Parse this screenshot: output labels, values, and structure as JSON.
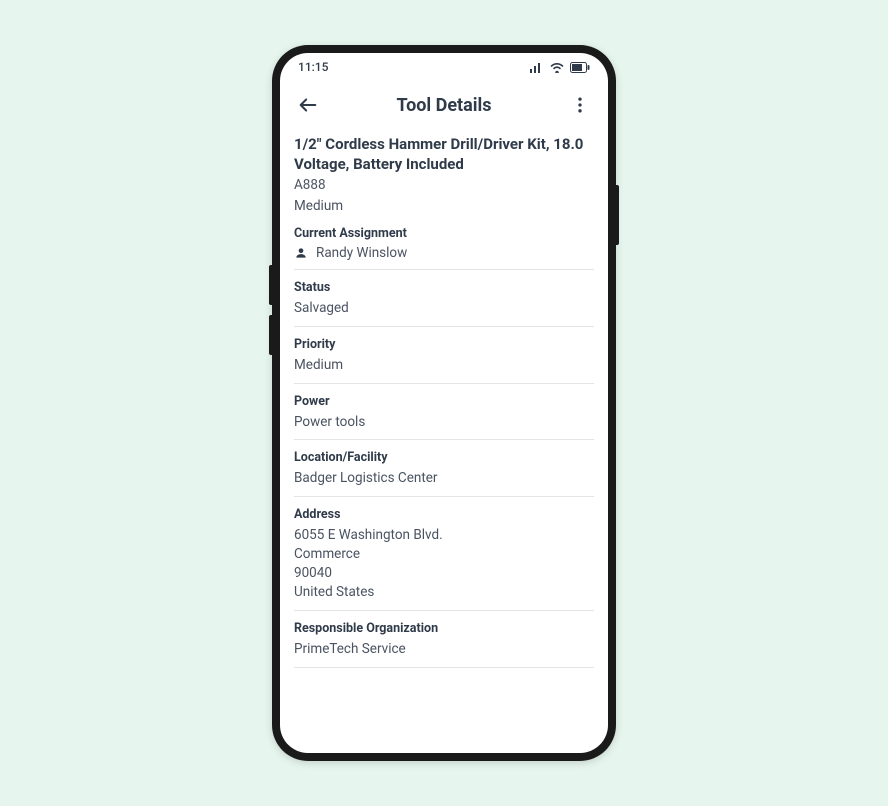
{
  "status_bar": {
    "time": "11:15"
  },
  "app_bar": {
    "title": "Tool Details"
  },
  "tool": {
    "name": "1/2\" Cordless Hammer Drill/Driver Kit, 18.0 Voltage, Battery Included",
    "code": "A888",
    "sub": "Medium"
  },
  "sections": {
    "assignment": {
      "label": "Current Assignment",
      "value": "Randy Winslow"
    },
    "status": {
      "label": "Status",
      "value": "Salvaged"
    },
    "priority": {
      "label": "Priority",
      "value": "Medium"
    },
    "power": {
      "label": "Power",
      "value": "Power tools"
    },
    "location": {
      "label": "Location/Facility",
      "value": "Badger Logistics Center"
    },
    "address": {
      "label": "Address",
      "line1": "6055 E Washington Blvd.",
      "line2": "Commerce",
      "line3": "90040",
      "line4": "United States"
    },
    "org": {
      "label": "Responsible Organization",
      "value": "PrimeTech Service"
    }
  }
}
